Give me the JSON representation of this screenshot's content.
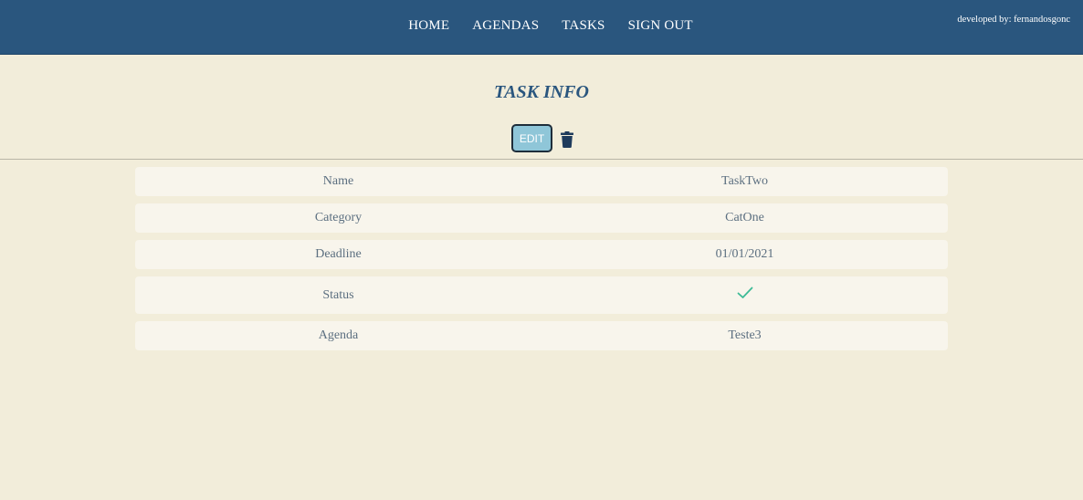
{
  "nav": {
    "items": [
      {
        "label": "HOME"
      },
      {
        "label": "AGENDAS"
      },
      {
        "label": "TASKS"
      },
      {
        "label": "SIGN OUT"
      }
    ],
    "credit": "developed by: fernandosgonc"
  },
  "page": {
    "title": "TASK INFO",
    "edit_label": "EDIT",
    "delete_icon": "trash-icon"
  },
  "task": {
    "name": {
      "label": "Name",
      "value": "TaskTwo"
    },
    "category": {
      "label": "Category",
      "value": "CatOne"
    },
    "deadline": {
      "label": "Deadline",
      "value": "01/01/2021"
    },
    "status": {
      "label": "Status",
      "value_icon": "check-icon"
    },
    "agenda": {
      "label": "Agenda",
      "value": "Teste3"
    }
  },
  "colors": {
    "navbar": "#2a567e",
    "background": "#f2edda",
    "row_background": "#f8f5ec",
    "edit_button": "#8fc6d8",
    "check": "#3dbb96"
  }
}
